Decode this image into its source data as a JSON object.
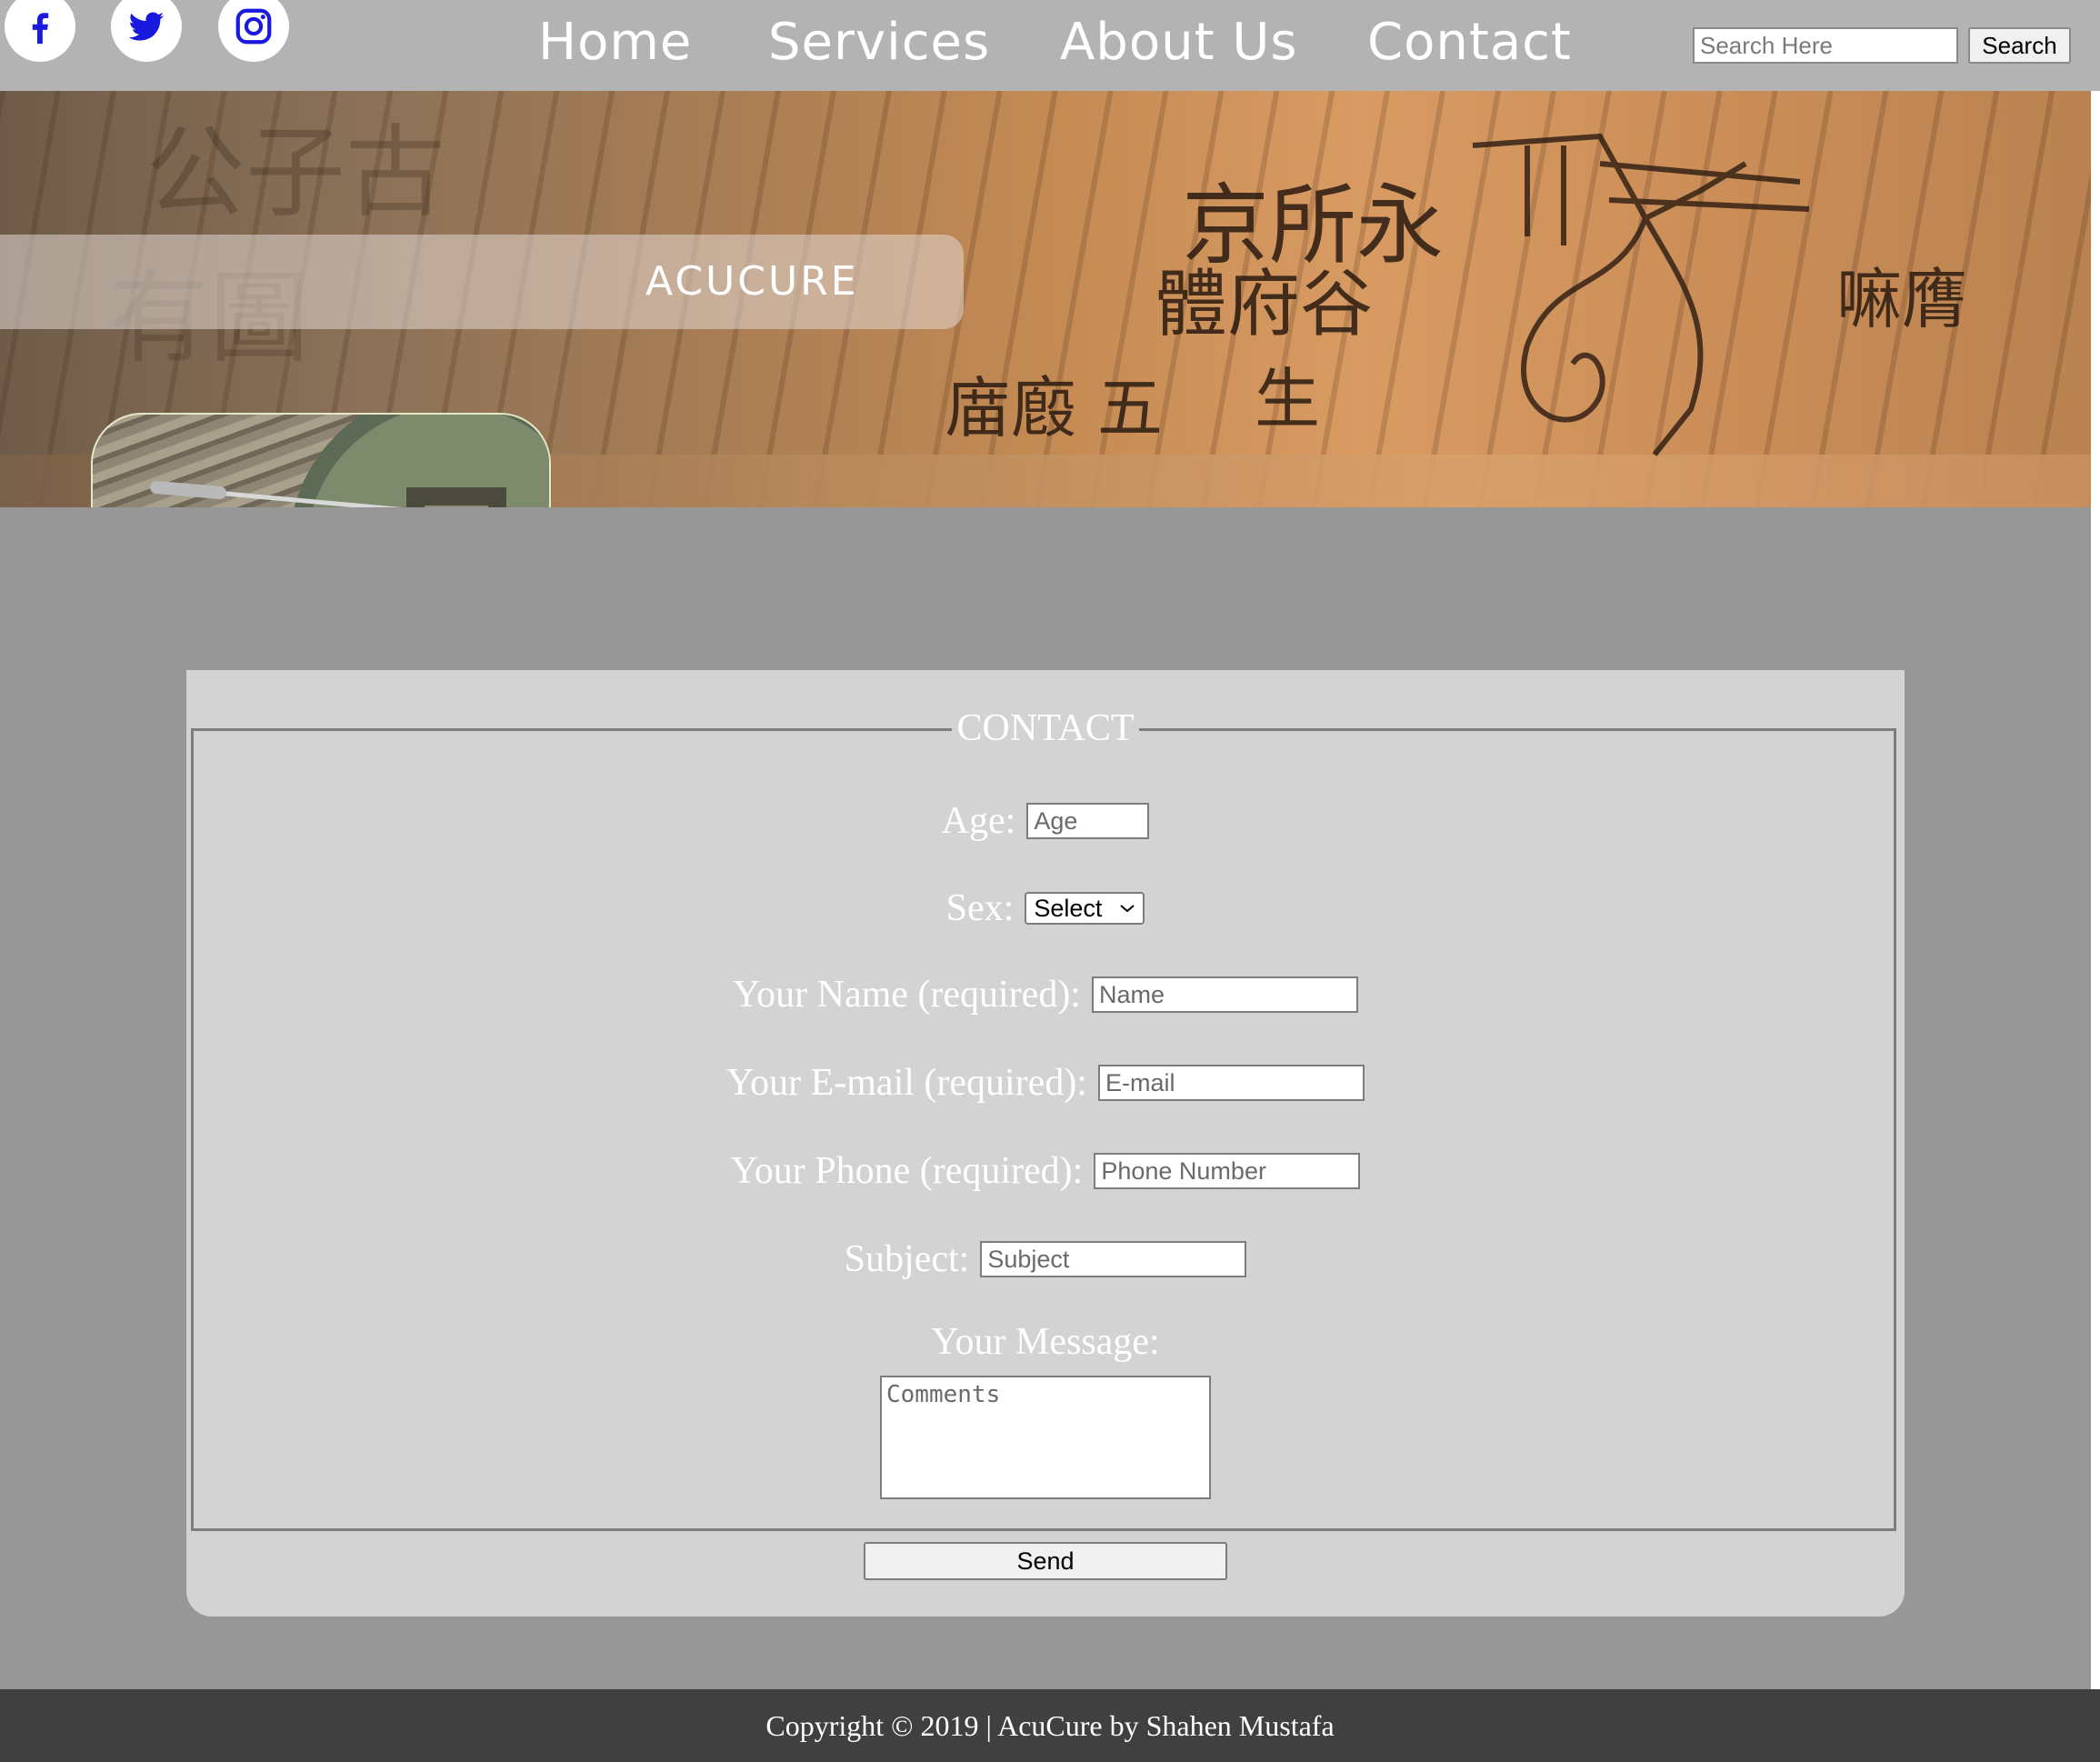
{
  "social": {
    "facebook": "facebook-icon",
    "twitter": "twitter-icon",
    "instagram": "instagram-icon",
    "icon_color": "#1a1adf"
  },
  "nav": {
    "home": "Home",
    "services": "Services",
    "about": "About Us",
    "contact": "Contact"
  },
  "search": {
    "placeholder": "Search Here",
    "button": "Search"
  },
  "hero": {
    "title": "ACUCURE"
  },
  "contact_form": {
    "legend": "CONTACT",
    "age_label": "Age:",
    "age_placeholder": "Age",
    "sex_label": "Sex:",
    "sex_selected": "Select",
    "name_label": "Your Name (required):",
    "name_placeholder": "Name",
    "email_label": "Your E-mail (required):",
    "email_placeholder": "E-mail",
    "phone_label": "Your Phone (required):",
    "phone_placeholder": "Phone Number",
    "subject_label": "Subject:",
    "subject_placeholder": "Subject",
    "message_label": "Your Message:",
    "message_placeholder": "Comments",
    "send_button": "Send"
  },
  "footer": {
    "text": "Copyright © 2019 | AcuCure by Shahen Mustafa"
  },
  "colors": {
    "topbar": "#b3b3b3",
    "page_background": "#979797",
    "card_background": "#d3d3d3",
    "footer_background": "#404040"
  }
}
